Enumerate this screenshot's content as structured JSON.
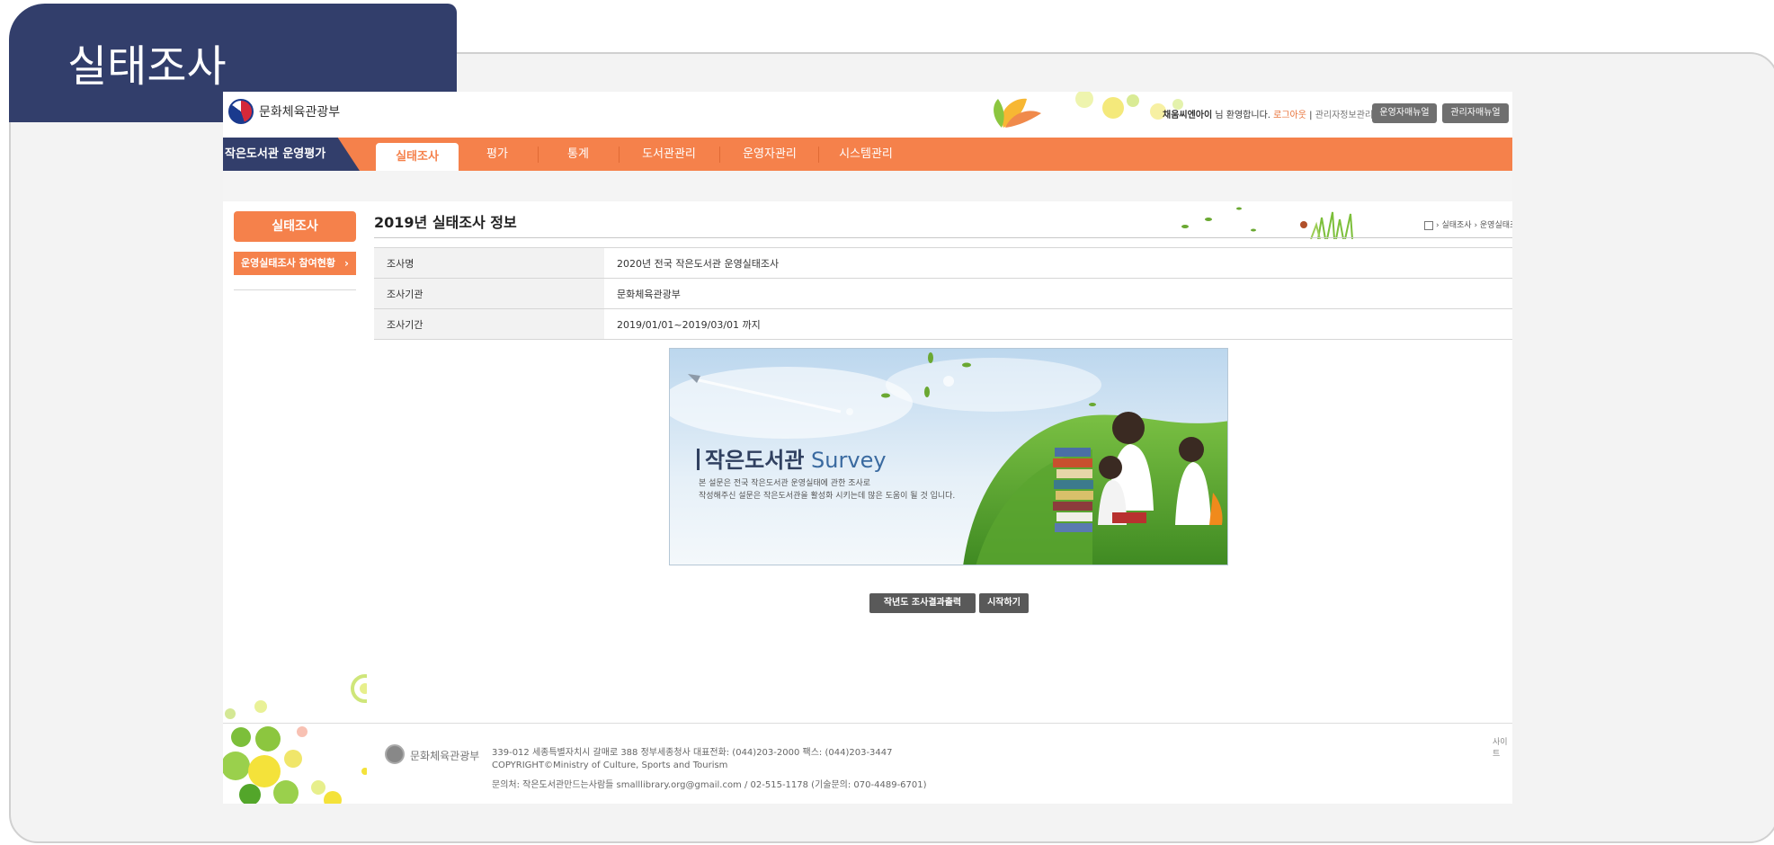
{
  "slide": {
    "title": "실태조사"
  },
  "header": {
    "logo_text": "문화체육관광부",
    "welcome_user": "채움씨엔아이",
    "welcome_suffix": "님 환영합니다.",
    "logout": "로그아웃",
    "separator": "|",
    "admin_info": "관리자정보관리",
    "buttons": [
      "운영자매뉴얼",
      "관리자매뉴얼"
    ]
  },
  "nav": {
    "brand": "작은도서관 운영평가",
    "items": [
      "실태조사",
      "평가",
      "통계",
      "도서관관리",
      "운영자관리",
      "시스템관리"
    ]
  },
  "sidebar": {
    "heading": "실태조사",
    "items": [
      {
        "label": "운영실태조사 참여현황",
        "chevron": "›"
      }
    ]
  },
  "content": {
    "title": "2019년 실태조사 정보",
    "breadcrumb": "› 실태조사 › 운영실태조",
    "table": [
      {
        "label": "조사명",
        "value": "2020년 전국 작은도서관 운영실태조사"
      },
      {
        "label": "조사기관",
        "value": "문화체육관광부"
      },
      {
        "label": "조사기간",
        "value": "2019/01/01~2019/03/01 까지"
      }
    ]
  },
  "banner": {
    "headline_accent": "작은도서관",
    "headline_en": "Survey",
    "line1": "본 설문은 전국 작은도서관 운영실태에 관한 조사로",
    "line2": "작성해주신 설문은 작은도서관을 활성화 시키는데 많은 도움이 될 것 입니다."
  },
  "actions": {
    "prev_results": "작년도 조사결과출력",
    "start": "시작하기"
  },
  "footer": {
    "logo_text": "문화체육관광부",
    "address": "339-012 세종특별자치시 갈매로 388 정부세종청사 대표전화: (044)203-2000 팩스: (044)203-3447",
    "copyright": "COPYRIGHT©Ministry of Culture, Sports and Tourism",
    "contact": "문의처: 작은도서관만드는사람들 smalllibrary.org@gmail.com / 02-515-1178 (기술문의: 070-4489-6701)",
    "sitemap": "사이트"
  },
  "colors": {
    "accent_orange": "#f5814b",
    "navy": "#323e6b",
    "button_gray": "#6f6f6f"
  }
}
